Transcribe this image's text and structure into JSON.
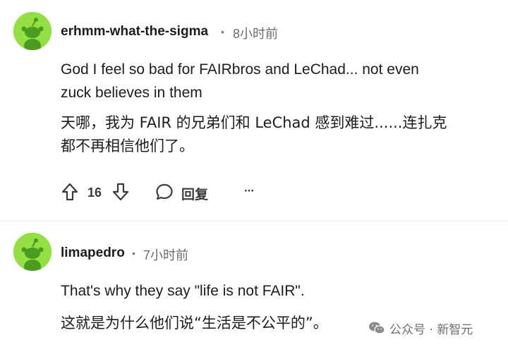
{
  "comments": [
    {
      "username": "erhmm-what-the-sigma",
      "separator": "•",
      "time": "8小时前",
      "body_en_line1": "God I feel so bad for FAIRbros and LeChad... not even",
      "body_en_line2": "zuck believes in them",
      "body_zh_line1": "天哪，我为 FAIR 的兄弟们和 LeChad 感到难过......连扎克",
      "body_zh_line2": "都不再相信他们了。",
      "vote_count": "16",
      "reply_label": "回复",
      "more_label": "···"
    },
    {
      "username": "limapedro",
      "separator": "•",
      "time": "7小时前",
      "body_en_line1": "That's why they say \"life is not FAIR\".",
      "body_zh_line1": "这就是为什么他们说“生活是不公平的”。"
    }
  ],
  "watermark": {
    "text": "公众号 · 新智元",
    "icon": "wechat-icon"
  },
  "colors": {
    "avatar_bg": "#94e044",
    "avatar_figure": "#4a9b1f",
    "text": "#1c1c1c",
    "muted": "#6b6b6b"
  }
}
